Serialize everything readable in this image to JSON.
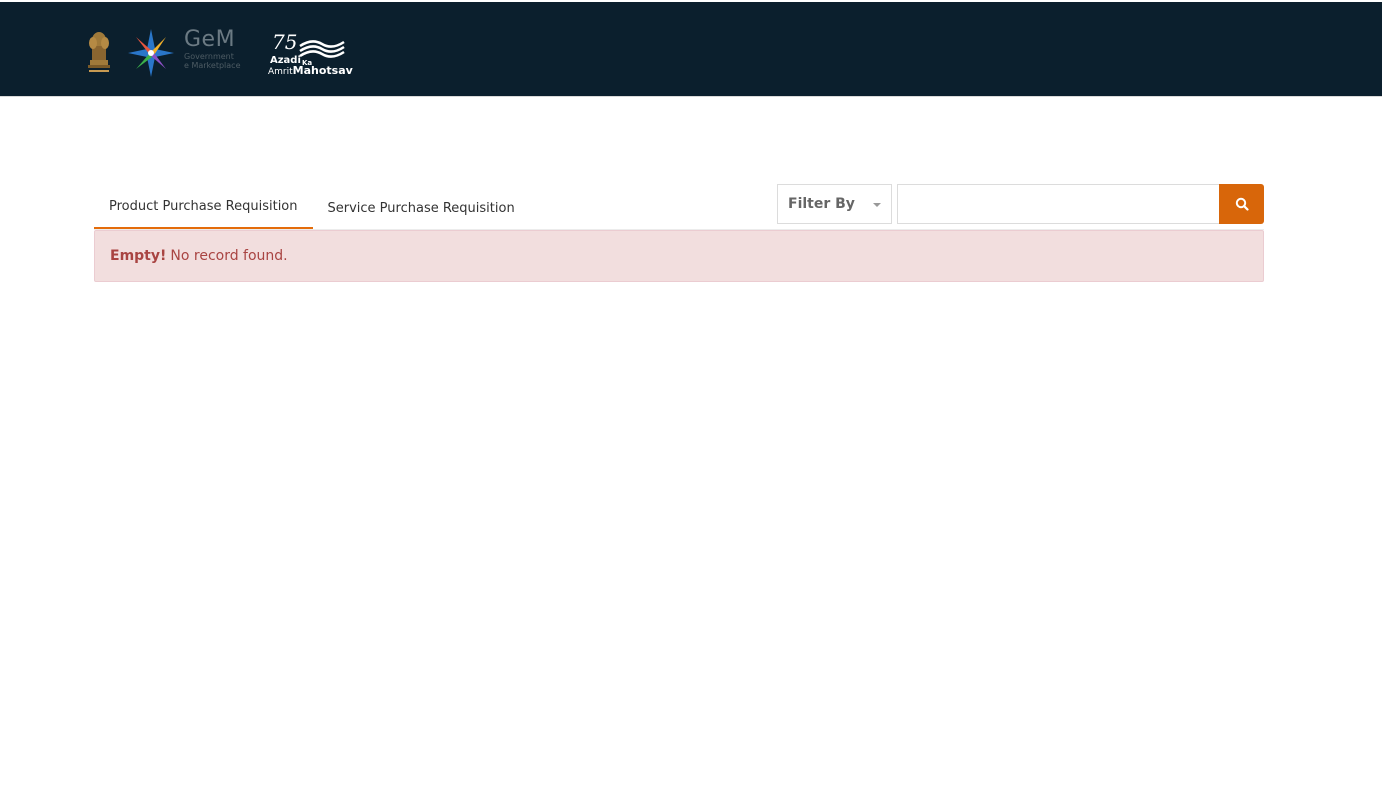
{
  "header": {
    "logos": {
      "emblem_icon": "national-emblem-icon",
      "gem_icon": "gem-star-icon",
      "gem_name": "GeM",
      "gem_subtitle_line1": "Government",
      "gem_subtitle_line2": "e Marketplace",
      "azadi_number": "75",
      "azadi_line1": "Azadi",
      "azadi_ka": "Ka",
      "azadi_line2a": "Amrit",
      "azadi_line2b": "Mahotsav"
    },
    "colors": {
      "background": "#0b1f2d"
    }
  },
  "tabs": [
    {
      "label": "Product Purchase Requisition",
      "active": true
    },
    {
      "label": "Service Purchase Requisition",
      "active": false
    }
  ],
  "filter": {
    "select_label": "Filter By",
    "search_value": "",
    "search_placeholder": "",
    "search_icon": "search-icon"
  },
  "alert": {
    "strong": "Empty!",
    "message": "No record found."
  },
  "colors": {
    "accent": "#d8660a",
    "alert_bg": "#f2dede",
    "alert_text": "#a94442"
  }
}
